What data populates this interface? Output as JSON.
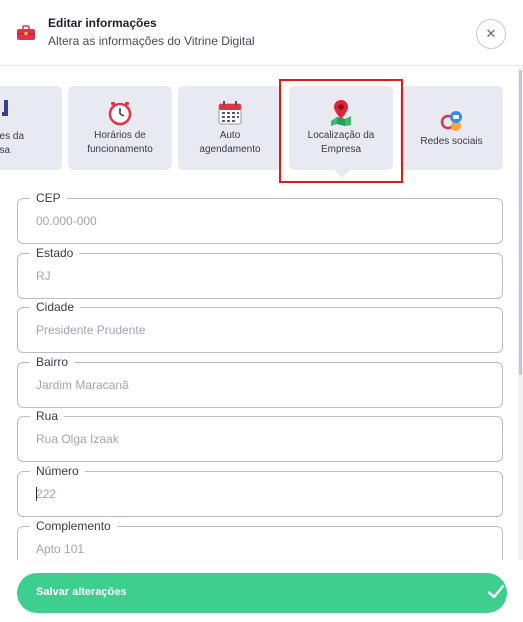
{
  "header": {
    "title": "Editar informações",
    "subtitle": "Altera as informações do Vitrine Digital",
    "icon": "briefcase-icon",
    "close_icon": "close-icon"
  },
  "tabs": [
    {
      "label_line1": "ões da",
      "label_line2": "esa",
      "icon": "partial-icon",
      "selected": false
    },
    {
      "label_line1": "Horários de",
      "label_line2": "funcionamento",
      "icon": "clock-icon",
      "selected": false
    },
    {
      "label_line1": "Auto",
      "label_line2": "agendamento",
      "icon": "calendar-icon",
      "selected": false
    },
    {
      "label_line1": "Localização da",
      "label_line2": "Empresa",
      "icon": "location-pin-icon",
      "selected": true
    },
    {
      "label_line1": "Redes sociais",
      "label_line2": "",
      "icon": "social-networks-icon",
      "selected": false
    }
  ],
  "form": {
    "cep": {
      "label": "CEP",
      "value": "",
      "placeholder": "00.000-000"
    },
    "estado": {
      "label": "Estado",
      "value": "RJ"
    },
    "cidade": {
      "label": "Cidade",
      "value": "Presidente Prudente"
    },
    "bairro": {
      "label": "Bairro",
      "value": "Jardim Maracanã"
    },
    "rua": {
      "label": "Rua",
      "value": "Rua Olga Izaak"
    },
    "numero": {
      "label": "Número",
      "value": "222"
    },
    "complemento": {
      "label": "Complemento",
      "value": "Apto 101"
    }
  },
  "footer": {
    "save_label": "Salvar alterações",
    "check_icon": "check-icon"
  },
  "colors": {
    "accent_green": "#3ecf8e",
    "tab_bg": "#e9e9f1",
    "highlight_red": "#e01a1a"
  }
}
